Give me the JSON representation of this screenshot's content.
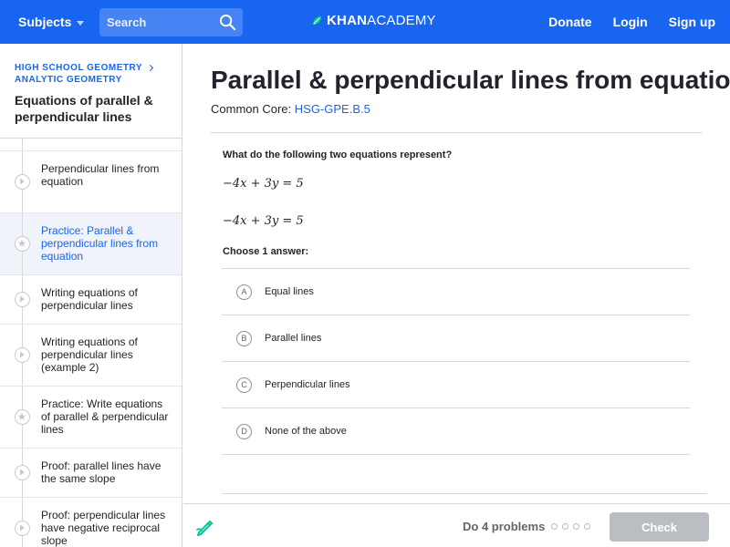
{
  "topbar": {
    "subjects_label": "Subjects",
    "search_placeholder": "Search",
    "brand_part1": "KHAN",
    "brand_part2": "ACADEMY",
    "nav": [
      "Donate",
      "Login",
      "Sign up"
    ],
    "accent": "#1865f2"
  },
  "sidebar": {
    "breadcrumb_1": "HIGH SCHOOL GEOMETRY",
    "breadcrumb_2": "ANALYTIC GEOMETRY",
    "title": "Equations of parallel & perpendicular lines",
    "items": [
      {
        "label": "Perpendicular lines from equation",
        "icon": "video-icon"
      },
      {
        "label": "Practice: Parallel & perpendicular lines from equation",
        "icon": "star-icon"
      },
      {
        "label": "Writing equations of perpendicular lines",
        "icon": "video-icon"
      },
      {
        "label": "Writing equations of perpendicular lines (example 2)",
        "icon": "video-icon"
      },
      {
        "label": "Practice: Write equations of parallel & perpendicular lines",
        "icon": "star-icon"
      },
      {
        "label": "Proof: parallel lines have the same slope",
        "icon": "video-icon"
      },
      {
        "label": "Proof: perpendicular lines have negative reciprocal slope",
        "icon": "video-icon"
      }
    ]
  },
  "main": {
    "title": "Parallel & perpendicular lines from equation",
    "common_core_label": "Common Core:",
    "common_core_code": "HSG-GPE.B.5",
    "question": "What do the following two equations represent?",
    "equations": [
      "−4x + 3y = 5",
      "−4x + 3y = 5"
    ],
    "choose_label": "Choose 1 answer:",
    "choices": [
      {
        "letter": "A",
        "text": "Equal lines"
      },
      {
        "letter": "B",
        "text": "Parallel lines"
      },
      {
        "letter": "C",
        "text": "Perpendicular lines"
      },
      {
        "letter": "D",
        "text": "None of the above"
      }
    ]
  },
  "bottombar": {
    "do_label": "Do 4 problems",
    "check_label": "Check"
  }
}
